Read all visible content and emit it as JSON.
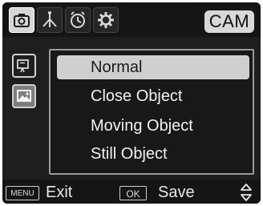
{
  "tabs": [
    {
      "icon": "camera-icon",
      "active": true
    },
    {
      "icon": "antenna-icon",
      "active": false
    },
    {
      "icon": "alarm-clock-icon",
      "active": false
    },
    {
      "icon": "gear-icon",
      "active": false
    }
  ],
  "mode_badge": "CAM",
  "side": [
    {
      "icon": "video-camera-icon",
      "active": false
    },
    {
      "icon": "picture-icon",
      "active": true
    }
  ],
  "menu": {
    "items": [
      "Normal",
      "Close Object",
      "Moving Object",
      "Still Object"
    ],
    "selected_index": 0
  },
  "footer": {
    "menu_key": "MENU",
    "exit_label": "Exit",
    "ok_key": "OK",
    "save_label": "Save"
  },
  "colors": {
    "screen_bg": "#1e1e1e",
    "highlight": "#cfcfcf",
    "text": "#f2f2f2"
  }
}
